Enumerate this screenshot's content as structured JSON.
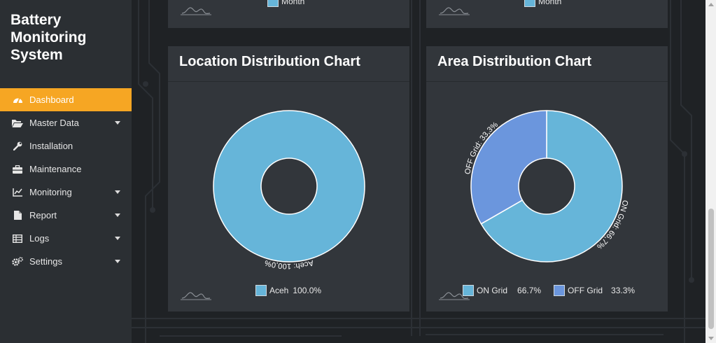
{
  "app": {
    "title_lines": [
      "Battery",
      "Monitoring",
      "System"
    ]
  },
  "sidebar": {
    "items": [
      {
        "label": "Dashboard",
        "icon": "dashboard-gauge-icon",
        "active": true,
        "caret": false
      },
      {
        "label": "Master Data",
        "icon": "folder-open-icon",
        "active": false,
        "caret": true
      },
      {
        "label": "Installation",
        "icon": "wrench-icon",
        "active": false,
        "caret": false
      },
      {
        "label": "Maintenance",
        "icon": "toolbox-icon",
        "active": false,
        "caret": false
      },
      {
        "label": "Monitoring",
        "icon": "line-chart-icon",
        "active": false,
        "caret": true
      },
      {
        "label": "Report",
        "icon": "file-icon",
        "active": false,
        "caret": true
      },
      {
        "label": "Logs",
        "icon": "table-icon",
        "active": false,
        "caret": true
      },
      {
        "label": "Settings",
        "icon": "cogs-icon",
        "active": false,
        "caret": true
      }
    ]
  },
  "top_panels": [
    {
      "legend_label": "Month"
    },
    {
      "legend_label": "Month"
    }
  ],
  "location_chart": {
    "title": "Location Distribution Chart",
    "chart_data": {
      "type": "pie",
      "categories": [
        "Aceh"
      ],
      "values": [
        100.0
      ],
      "slice_labels": [
        "Aceh: 100,0%"
      ],
      "legend": [
        {
          "label": "Aceh",
          "pct": "100.0%"
        }
      ],
      "colors": [
        "#66b5d9"
      ],
      "donut": true
    }
  },
  "area_chart": {
    "title": "Area Distribution Chart",
    "chart_data": {
      "type": "pie",
      "categories": [
        "ON Grid",
        "OFF Grid"
      ],
      "values": [
        66.7,
        33.3
      ],
      "slice_labels": [
        "ON Grid: 66,7%",
        "OFF Grid: 33,3%"
      ],
      "legend": [
        {
          "label": "ON Grid",
          "pct": "66.7%"
        },
        {
          "label": "OFF Grid",
          "pct": "33.3%"
        }
      ],
      "colors": [
        "#66b5d9",
        "#6b96dd"
      ],
      "donut": true
    }
  },
  "colors": {
    "sidebar_bg": "#2b2f33",
    "active_item": "#f6a623",
    "panel_bg": "#32363b",
    "page_bg": "#1f2225"
  }
}
